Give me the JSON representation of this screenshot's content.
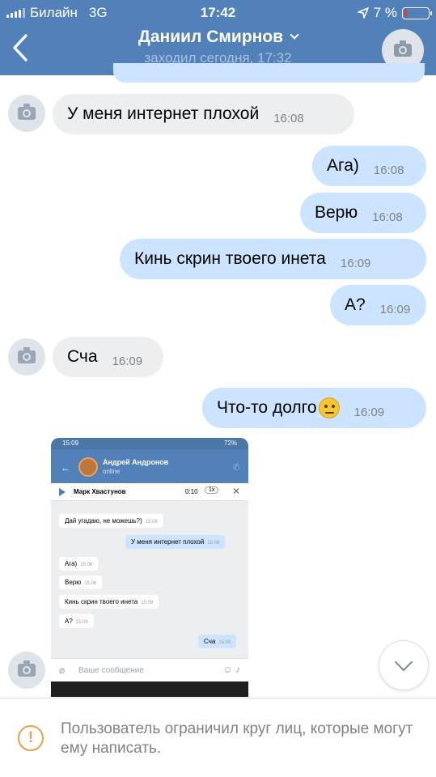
{
  "status_bar": {
    "carrier": "Билайн",
    "network": "3G",
    "time": "17:42",
    "battery": "7 %"
  },
  "header": {
    "name": "Даниил Смирнов",
    "last_seen": "заходил сегодня, 17:32"
  },
  "messages": [
    {
      "dir": "in",
      "text": "У меня интернет плохой",
      "time": "16:08"
    },
    {
      "dir": "out",
      "text": "Ага)",
      "time": "16:08"
    },
    {
      "dir": "out",
      "text": "Верю",
      "time": "16:08"
    },
    {
      "dir": "out",
      "text": "Кинь скрин твоего инета",
      "time": "16:09"
    },
    {
      "dir": "out",
      "text": "А?",
      "time": "16:09"
    },
    {
      "dir": "in",
      "text": "Сча",
      "time": "16:09"
    },
    {
      "dir": "out",
      "text": "Что-то долго",
      "time": "16:09"
    }
  ],
  "attachment": {
    "status_time": "15:09",
    "status_battery": "72%",
    "contact_name": "Андрей Андронов",
    "contact_status": "online",
    "player_artist": "Марк Хвастунов",
    "player_time": "0:10",
    "player_speed": "1x",
    "messages": [
      {
        "text": "Дай угадаю, не можешь?)",
        "time": "15:08"
      },
      {
        "text": "У меня интернет плохой",
        "time": "15:08"
      },
      {
        "text": "Ага)",
        "time": "15:08"
      },
      {
        "text": "Верю",
        "time": "15:08"
      },
      {
        "text": "Кинь скрин твоего инета",
        "time": "15:09"
      },
      {
        "text": "А?",
        "time": "15:09"
      },
      {
        "text": "Сча",
        "time": "15:09"
      }
    ],
    "input_placeholder": "Ваше сообщение"
  },
  "footer": {
    "notice": "Пользователь ограничил круг лиц, которые могут ему написать."
  },
  "colors": {
    "header": "#5181b8",
    "bubble_in": "#edeef0",
    "bubble_out": "#cce4ff",
    "warning": "#e8a04a"
  },
  "icons": [
    "back-icon",
    "chevron-down-icon",
    "camera-icon",
    "location-arrow-icon",
    "battery-icon",
    "warning-icon"
  ]
}
